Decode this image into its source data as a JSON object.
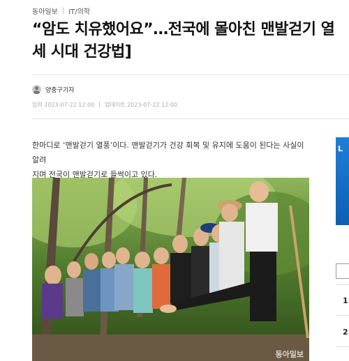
{
  "breadcrumb": {
    "source": "동아일보",
    "section": "IT/의학"
  },
  "article": {
    "headline": "“암도 치유했어요”…전국에 몰아친 맨발걷기 열\n세 시대 건강법]",
    "author": "양충구기자",
    "published": "입력 2023-07-22 12:00",
    "updated": "업데이트 2023-07-22 12:00",
    "body_lines": [
      "한마디로 ‘맨발걷기 열풍’이다. 맨발걷기가 건강 회복 및 유지에 도움이 된다는 사실이 알려",
      "지며 전국이 맨발걷기로 들썩이고 있다."
    ],
    "photo_watermark": "동아일보"
  },
  "sidebar": {
    "ad_letter": "L",
    "ranks": [
      "1",
      "2"
    ]
  },
  "colors": {
    "ad_blue": "#1f7fd6",
    "date_gray": "#aaaaaa"
  }
}
